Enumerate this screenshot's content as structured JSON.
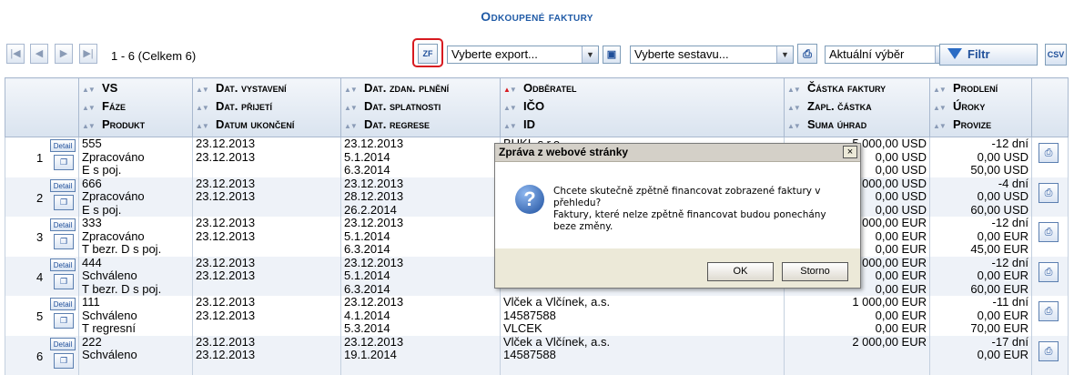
{
  "page": {
    "title": "Odkoupené faktury"
  },
  "pager": {
    "first": "|◀",
    "prev": "◀",
    "next": "▶",
    "last": "▶|",
    "info": "1 - 6 (Celkem 6)"
  },
  "toolbar": {
    "zf_label": "ZF",
    "export_select": "Vyberte export...",
    "report_select": "Vyberte sestavu...",
    "scope_select": "Aktuální výběr",
    "filter_label": "Filtr",
    "csv_label": "CSV"
  },
  "columns": {
    "c1": [
      "VS",
      "Fáze",
      "Produkt"
    ],
    "c2": [
      "Dat. vystavení",
      "Dat. přijetí",
      "Datum ukončení"
    ],
    "c3": [
      "Dat. zdan. plnění",
      "Dat. splatnosti",
      "Dat. regrese"
    ],
    "c4": [
      "Odběratel",
      "IČO",
      "ID"
    ],
    "c5": [
      "Částka faktury",
      "Zapl. částka",
      "Suma úhrad"
    ],
    "c6": [
      "Prodlení",
      "Úroky",
      "Provize"
    ]
  },
  "row_buttons": {
    "detail": "Detail"
  },
  "rows": [
    {
      "n": "1",
      "a": [
        "555",
        "Zpracováno",
        "E s poj."
      ],
      "b": [
        "23.12.2013",
        "23.12.2013",
        ""
      ],
      "c": [
        "23.12.2013",
        "5.1.2014",
        "6.3.2014"
      ],
      "d": [
        "BUKI, s.r.o.",
        "",
        ""
      ],
      "e": [
        "5 000,00 USD",
        "0,00 USD",
        "0,00 USD"
      ],
      "f": [
        "-12 dní",
        "0,00 USD",
        "50,00 USD"
      ]
    },
    {
      "n": "2",
      "a": [
        "666",
        "Zpracováno",
        "E s poj."
      ],
      "b": [
        "23.12.2013",
        "23.12.2013",
        ""
      ],
      "c": [
        "23.12.2013",
        "28.12.2013",
        "26.2.2014"
      ],
      "d": [
        "",
        "",
        ""
      ],
      "e": [
        "000,00 USD",
        "0,00 USD",
        "0,00 USD"
      ],
      "f": [
        "-4 dní",
        "0,00 USD",
        "60,00 USD"
      ]
    },
    {
      "n": "3",
      "a": [
        "333",
        "Zpracováno",
        "T bezr. D s poj."
      ],
      "b": [
        "23.12.2013",
        "23.12.2013",
        ""
      ],
      "c": [
        "23.12.2013",
        "5.1.2014",
        "6.3.2014"
      ],
      "d": [
        "",
        "",
        ""
      ],
      "e": [
        "000,00 EUR",
        "0,00 EUR",
        "0,00 EUR"
      ],
      "f": [
        "-12 dní",
        "0,00 EUR",
        "45,00 EUR"
      ]
    },
    {
      "n": "4",
      "a": [
        "444",
        "Schváleno",
        "T bezr. D s poj."
      ],
      "b": [
        "23.12.2013",
        "23.12.2013",
        ""
      ],
      "c": [
        "23.12.2013",
        "5.1.2014",
        "6.3.2014"
      ],
      "d": [
        "",
        "",
        ""
      ],
      "e": [
        "000,00 EUR",
        "0,00 EUR",
        "0,00 EUR"
      ],
      "f": [
        "-12 dní",
        "0,00 EUR",
        "60,00 EUR"
      ]
    },
    {
      "n": "5",
      "a": [
        "111",
        "Schváleno",
        "T regresní"
      ],
      "b": [
        "23.12.2013",
        "23.12.2013",
        ""
      ],
      "c": [
        "23.12.2013",
        "4.1.2014",
        "5.3.2014"
      ],
      "d": [
        "Vlček a Vlčínek, a.s.",
        "14587588",
        "VLCEK"
      ],
      "e": [
        "1 000,00 EUR",
        "0,00 EUR",
        "0,00 EUR"
      ],
      "f": [
        "-11 dní",
        "0,00 EUR",
        "70,00 EUR"
      ]
    },
    {
      "n": "6",
      "a": [
        "222",
        "Schváleno",
        ""
      ],
      "b": [
        "23.12.2013",
        "23.12.2013",
        ""
      ],
      "c": [
        "23.12.2013",
        "19.1.2014",
        ""
      ],
      "d": [
        "Vlček a Vlčínek, a.s.",
        "14587588",
        ""
      ],
      "e": [
        "2 000,00 EUR",
        "",
        ""
      ],
      "f": [
        "-17 dní",
        "0,00 EUR",
        ""
      ]
    }
  ],
  "dialog": {
    "title": "Zpráva z webové stránky",
    "message_1": "Chcete skutečně zpětně financovat zobrazené faktury v přehledu?",
    "message_2": "Faktury, které nelze zpětně financovat budou ponechány beze změny.",
    "ok": "OK",
    "cancel": "Storno",
    "close": "×",
    "icon": "?"
  }
}
